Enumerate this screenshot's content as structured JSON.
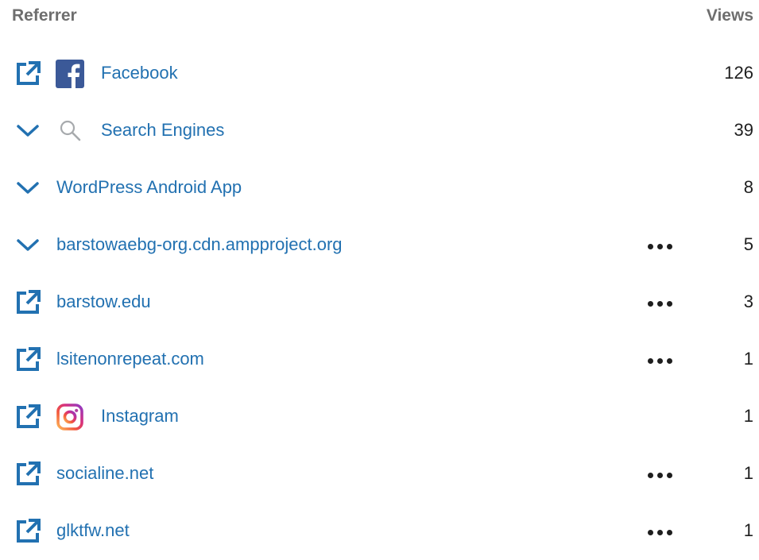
{
  "header": {
    "referrer_label": "Referrer",
    "views_label": "Views"
  },
  "colors": {
    "link": "#2271b1",
    "text": "#1e1e1e",
    "header": "#6e6e6e",
    "facebook": "#3b5998"
  },
  "rows": [
    {
      "label": "Facebook",
      "views": "126",
      "lead_icon": "external-link-icon",
      "logo": "facebook-logo",
      "has_more": false
    },
    {
      "label": "Search Engines",
      "views": "39",
      "lead_icon": "chevron-down-icon",
      "logo": "search-icon",
      "has_more": false
    },
    {
      "label": "WordPress Android App",
      "views": "8",
      "lead_icon": "chevron-down-icon",
      "logo": null,
      "has_more": false
    },
    {
      "label": "barstowaebg-org.cdn.ampproject.org",
      "views": "5",
      "lead_icon": "chevron-down-icon",
      "logo": null,
      "has_more": true
    },
    {
      "label": "barstow.edu",
      "views": "3",
      "lead_icon": "external-link-icon",
      "logo": null,
      "has_more": true
    },
    {
      "label": "lsitenonrepeat.com",
      "views": "1",
      "lead_icon": "external-link-icon",
      "logo": null,
      "has_more": true
    },
    {
      "label": "Instagram",
      "views": "1",
      "lead_icon": "external-link-icon",
      "logo": "instagram-logo",
      "has_more": false
    },
    {
      "label": "socialine.net",
      "views": "1",
      "lead_icon": "external-link-icon",
      "logo": null,
      "has_more": true
    },
    {
      "label": "glktfw.net",
      "views": "1",
      "lead_icon": "external-link-icon",
      "logo": null,
      "has_more": true
    }
  ]
}
